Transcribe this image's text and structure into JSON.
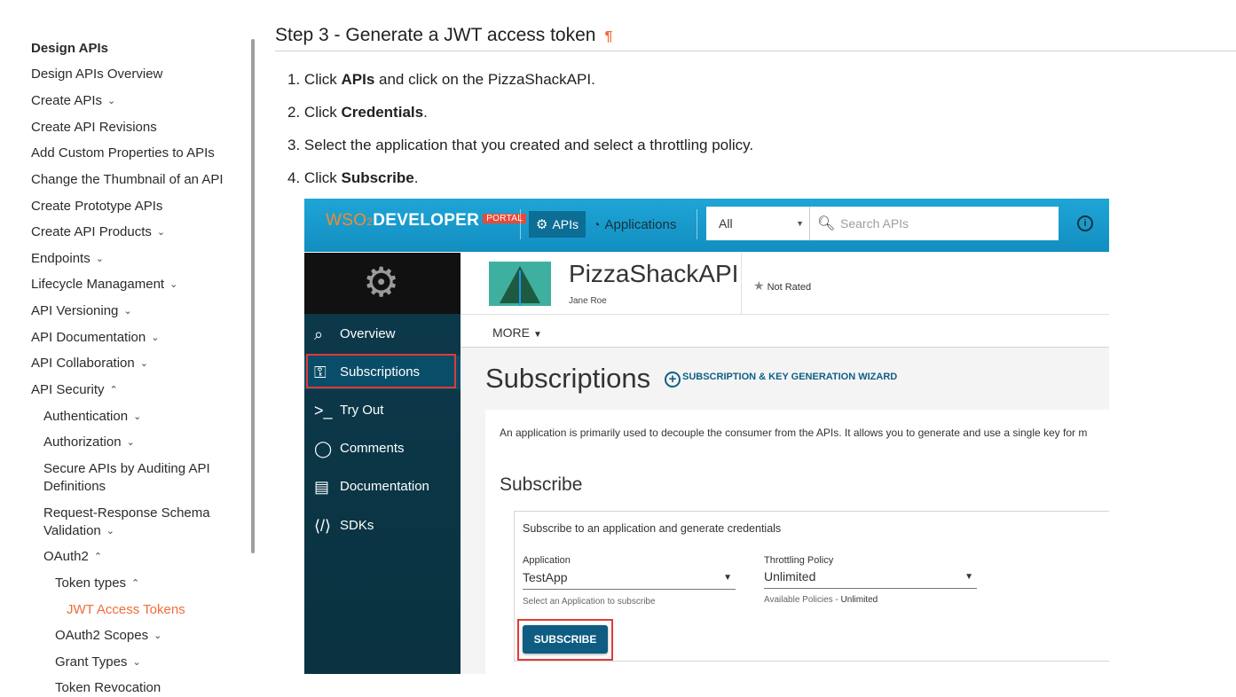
{
  "nav": {
    "heading": "Design APIs",
    "items": [
      {
        "label": "Design APIs Overview",
        "chevron": ""
      },
      {
        "label": "Create APIs",
        "chevron": "⌄"
      },
      {
        "label": "Create API Revisions",
        "chevron": ""
      },
      {
        "label": "Add Custom Properties to APIs",
        "chevron": ""
      },
      {
        "label": "Change the Thumbnail of an API",
        "chevron": ""
      },
      {
        "label": "Create Prototype APIs",
        "chevron": ""
      },
      {
        "label": "Create API Products",
        "chevron": "⌄"
      },
      {
        "label": "Endpoints",
        "chevron": "⌄"
      },
      {
        "label": "Lifecycle Managament",
        "chevron": "⌄"
      },
      {
        "label": "API Versioning",
        "chevron": "⌄"
      },
      {
        "label": "API Documentation",
        "chevron": "⌄"
      },
      {
        "label": "API Collaboration",
        "chevron": "⌄"
      },
      {
        "label": "API Security",
        "chevron": "⌃"
      },
      {
        "label": "Authentication",
        "chevron": "⌄"
      },
      {
        "label": "Authorization",
        "chevron": "⌄"
      },
      {
        "label": "Secure APIs by Auditing API Definitions",
        "chevron": ""
      },
      {
        "label": "Request-Response Schema Validation",
        "chevron": "⌄"
      },
      {
        "label": "OAuth2",
        "chevron": "⌃"
      },
      {
        "label": "Token types",
        "chevron": "⌃"
      },
      {
        "label": "JWT Access Tokens",
        "chevron": ""
      },
      {
        "label": "OAuth2 Scopes",
        "chevron": "⌄"
      },
      {
        "label": "Grant Types",
        "chevron": "⌄"
      },
      {
        "label": "Token Revocation",
        "chevron": ""
      }
    ]
  },
  "doc": {
    "title": "Step 3 - Generate a JWT access token",
    "pilcrow": "¶",
    "steps": [
      {
        "num": "1.",
        "pre": "Click ",
        "bold": "APIs",
        "post": " and click on the PizzaShackAPI."
      },
      {
        "num": "2.",
        "pre": "Click ",
        "bold": "Credentials",
        "post": "."
      },
      {
        "num": "3.",
        "pre": "Select the application that you created and select a throttling policy.",
        "bold": "",
        "post": ""
      },
      {
        "num": "4.",
        "pre": "Click ",
        "bold": "Subscribe",
        "post": "."
      }
    ]
  },
  "portal": {
    "logo_wso": "WSO",
    "logo_two": "2",
    "logo_developer": "DEVELOPER",
    "logo_portal_tag": "PORTAL",
    "apis_tab": "APIs",
    "applications_tab": "Applications",
    "category_selected": "All",
    "search_placeholder": "Search APIs",
    "info_icon": "i",
    "sidebar": [
      {
        "label": "Overview",
        "icon": "overview-icon"
      },
      {
        "label": "Subscriptions",
        "icon": "subscriptions-icon"
      },
      {
        "label": "Try Out",
        "icon": "terminal-icon"
      },
      {
        "label": "Comments",
        "icon": "comment-icon"
      },
      {
        "label": "Documentation",
        "icon": "documentation-icon"
      },
      {
        "label": "SDKs",
        "icon": "code-icon"
      }
    ],
    "api_name": "PizzaShackAPI",
    "api_owner": "Jane Roe",
    "rating": "Not Rated",
    "more": "MORE",
    "subscriptions_heading": "Subscriptions",
    "wizard_link": "SUBSCRIPTION & KEY GENERATION WIZARD",
    "description": "An application is primarily used to decouple the consumer from the APIs. It allows you to generate and use a single key for m",
    "subscribe_title": "Subscribe",
    "box_caption": "Subscribe to an application and generate credentials",
    "application_label": "Application",
    "application_value": "TestApp",
    "application_help": "Select an Application to subscribe",
    "policy_label": "Throttling Policy",
    "policy_value": "Unlimited",
    "policy_help_prefix": "Available Policies - ",
    "policy_help_value": "Unlimited",
    "subscribe_button": "SUBSCRIBE"
  }
}
